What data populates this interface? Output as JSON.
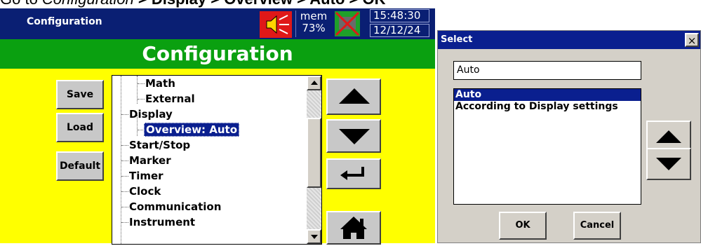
{
  "caption": {
    "prefix": "Go to ",
    "italic_part": "Configuration",
    "bold_part": " > Display > Overview > Auto > OK"
  },
  "device": {
    "window_title": "Configuration",
    "mem_label": "mem",
    "mem_value": "73%",
    "time": "15:48:30",
    "date": "12/12/24",
    "banner": "Configuration",
    "side_buttons": [
      "Save",
      "Load",
      "Default"
    ],
    "tree": [
      {
        "label": "Math",
        "level": 1
      },
      {
        "label": "External",
        "level": 1
      },
      {
        "label": "Display",
        "level": 0
      },
      {
        "label": "Overview: Auto",
        "level": 1,
        "selected": true
      },
      {
        "label": "Start/Stop",
        "level": 0
      },
      {
        "label": "Marker",
        "level": 0
      },
      {
        "label": "Timer",
        "level": 0
      },
      {
        "label": "Clock",
        "level": 0
      },
      {
        "label": "Communication",
        "level": 0
      },
      {
        "label": "Instrument",
        "level": 0
      }
    ],
    "nav_icons": [
      "up-arrow-icon",
      "down-arrow-icon",
      "enter-icon",
      "home-icon"
    ]
  },
  "dialog": {
    "title": "Select",
    "close_glyph": "×",
    "input_value": "Auto",
    "options": [
      "Auto",
      "According to Display settings"
    ],
    "selected_option": 0,
    "ok_label": "OK",
    "cancel_label": "Cancel"
  },
  "colors": {
    "titlebar": "#0a1f73",
    "banner": "#0aa010",
    "background": "#ffff00",
    "selection": "#0a1f8f"
  }
}
